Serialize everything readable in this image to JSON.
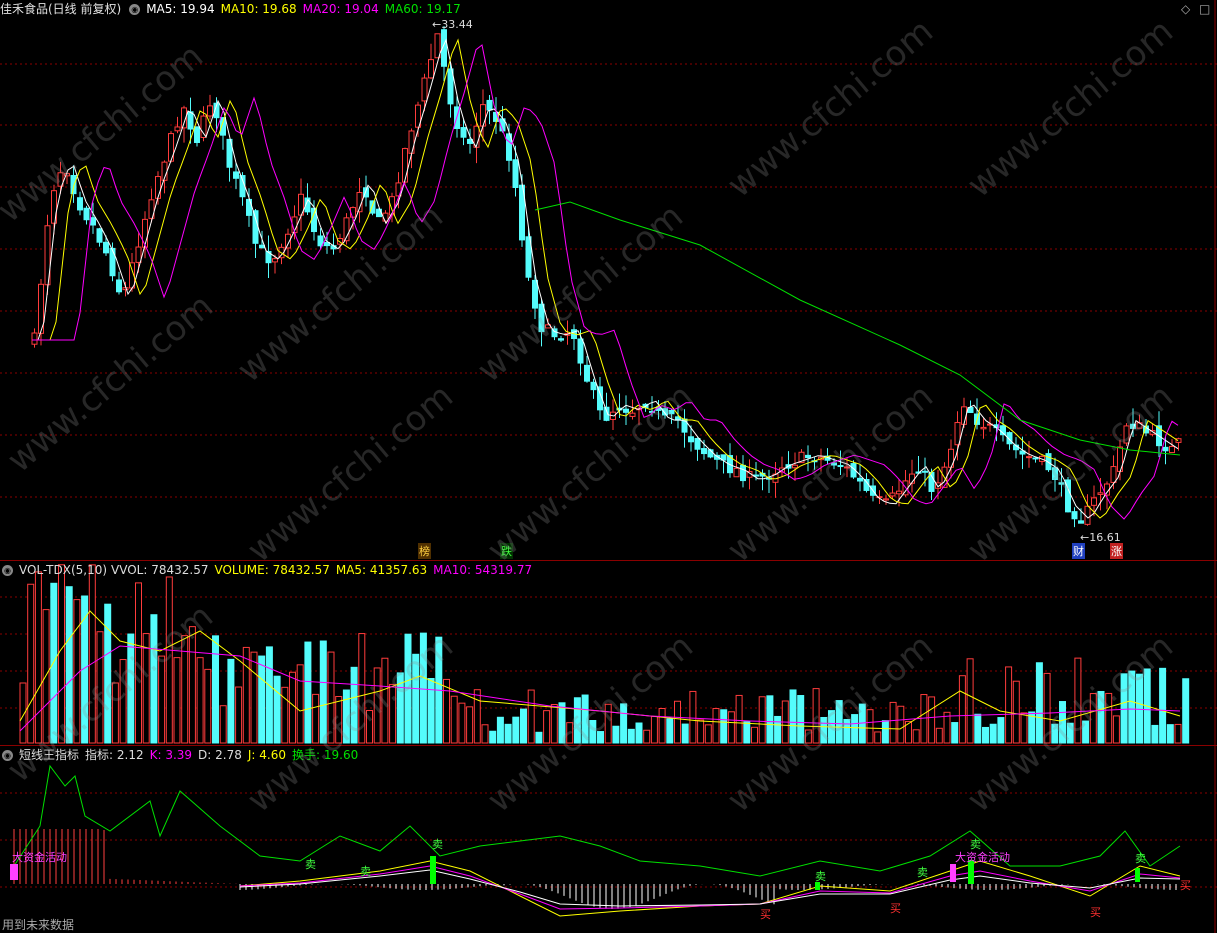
{
  "main": {
    "title": "佳禾食品(日线 前复权)",
    "ma5": "MA5: 19.94",
    "ma10": "MA10: 19.68",
    "ma20": "MA20: 19.04",
    "ma60": "MA60: 19.17",
    "high_label": "33.44",
    "low_label": "16.61",
    "tags": [
      "榜",
      "跌",
      "财",
      "涨"
    ],
    "colors": {
      "up": "#ff3c3c",
      "down": "#54fcfc",
      "ma5": "#ffffff",
      "ma10": "#ffff00",
      "ma20": "#ff00ff",
      "ma60": "#00e000",
      "grid": "#8a0000"
    }
  },
  "volume": {
    "name": "VOL-TDX(5,10)",
    "vvol": "VVOL: 78432.57",
    "volume": "VOLUME: 78432.57",
    "ma5": "MA5: 41357.63",
    "ma10": "MA10: 54319.77"
  },
  "indicator": {
    "name": "短线王指标",
    "zhibiao": "指标: 2.12",
    "k": "K: 3.39",
    "d": "D: 2.78",
    "j": "J: 4.60",
    "huanshou": "换手: 19.60",
    "labels": [
      "大资金活动",
      "大资金活动",
      "卖",
      "卖",
      "卖",
      "卖",
      "卖",
      "卖",
      "卖",
      "买",
      "买",
      "买",
      "买"
    ]
  },
  "footer": "用到未来数据",
  "watermark": "www.cfchi.com",
  "icons": [
    "circle-settings-icon",
    "diamond-icon",
    "square-icon"
  ]
}
